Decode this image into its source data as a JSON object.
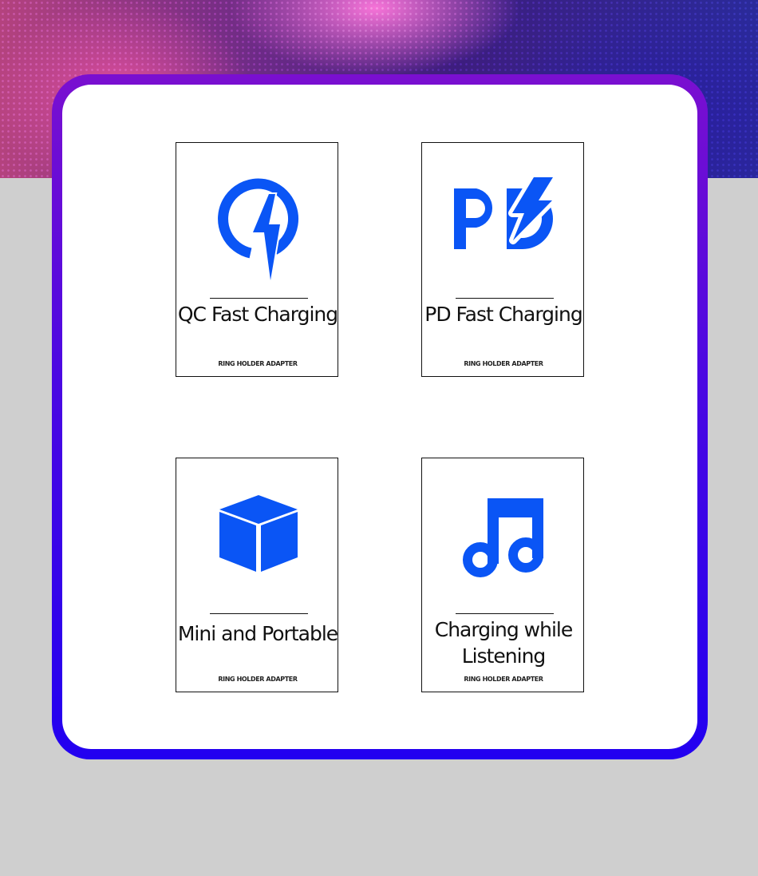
{
  "accent_color": "#0a55f5",
  "tiles": [
    {
      "icon": "quick-charge-icon",
      "title": "QC Fast Charging",
      "caption": "RING HOLDER ADAPTER"
    },
    {
      "icon": "power-delivery-icon",
      "title": "PD Fast Charging",
      "caption": "RING HOLDER ADAPTER"
    },
    {
      "icon": "cube-icon",
      "title": "Mini and Portable",
      "caption": "RING HOLDER ADAPTER"
    },
    {
      "icon": "music-note-icon",
      "title": "Charging while Listening",
      "caption": "RING HOLDER ADAPTER"
    }
  ]
}
